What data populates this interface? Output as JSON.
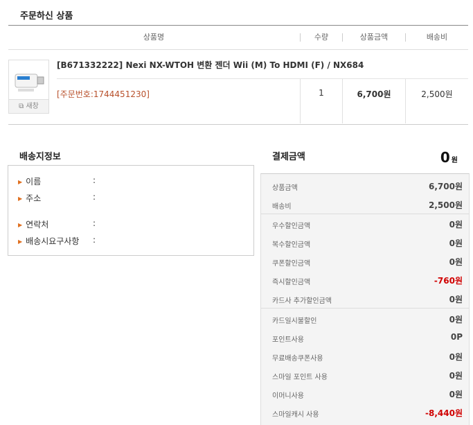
{
  "order_section": {
    "title": "주문하신 상품"
  },
  "table_headers": {
    "product": "상품명",
    "qty": "수량",
    "amount": "상품금액",
    "shipping": "배송비"
  },
  "item": {
    "name": "[B671332222] Nexi NX-WTOH 변환 젠더 Wii (M) To HDMI (F) / NX684",
    "order_number": "[주문번호:1744451230]",
    "qty": "1",
    "price": "6,700원",
    "shipping": "2,500원",
    "new_window_label": "새창",
    "thumb_icon": "wii-hdmi-adapter-icon"
  },
  "shipping_info": {
    "title": "배송지정보",
    "fields": [
      {
        "label": "이름",
        "value": ""
      },
      {
        "label": "주소",
        "value": ""
      },
      {
        "label": "연락처",
        "value": ""
      },
      {
        "label": "배송시요구사항",
        "value": ""
      }
    ],
    "colon": ":"
  },
  "payment": {
    "title": "결제금액",
    "total_value": "0",
    "total_unit": "원",
    "rows": [
      {
        "label": "상품금액",
        "value": "6,700원",
        "red": false
      },
      {
        "label": "배송비",
        "value": "2,500원",
        "red": false
      },
      {
        "label": "우수할인금액",
        "value": "0원",
        "red": false
      },
      {
        "label": "복수할인금액",
        "value": "0원",
        "red": false
      },
      {
        "label": "쿠폰할인금액",
        "value": "0원",
        "red": false
      },
      {
        "label": "즉시할인금액",
        "value": "-760원",
        "red": true
      },
      {
        "label": "카드사 추가할인금액",
        "value": "0원",
        "red": false
      },
      {
        "label": "카드일시불할인",
        "value": "0원",
        "red": false
      },
      {
        "label": "포인트사용",
        "value": "0P",
        "red": false
      },
      {
        "label": "무료배송쿠폰사용",
        "value": "0원",
        "red": false
      },
      {
        "label": "스마일 포인트 사용",
        "value": "0원",
        "red": false
      },
      {
        "label": "이머니사용",
        "value": "0원",
        "red": false
      },
      {
        "label": "스마일캐시 사용",
        "value": "-8,440원",
        "red": true
      }
    ],
    "colors": {
      "accent_red": "#d00000",
      "order_no": "#b8502b",
      "arrow": "#e07020"
    }
  }
}
